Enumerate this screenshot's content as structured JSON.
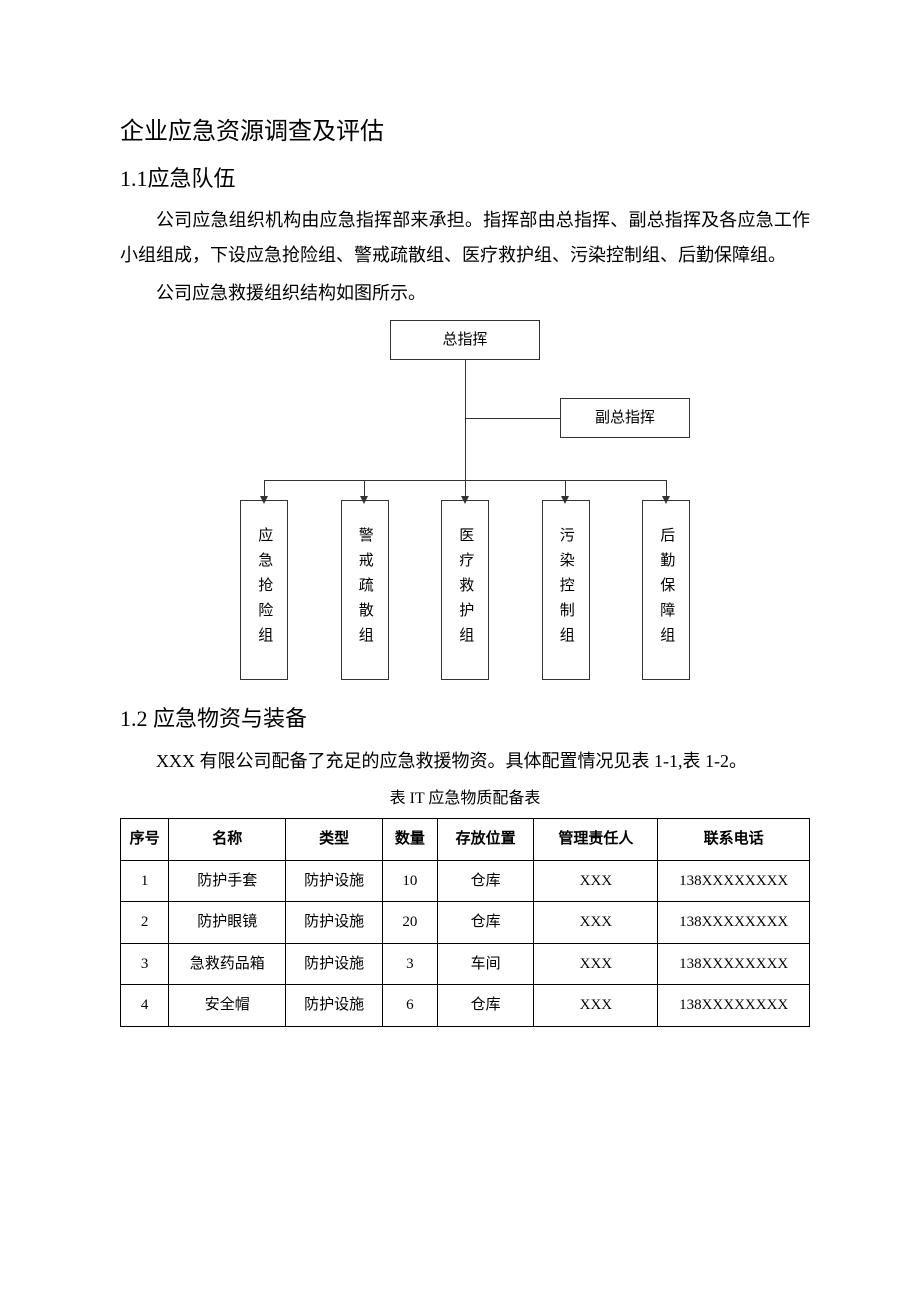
{
  "doc_title": "企业应急资源调查及评估",
  "sec11": {
    "heading": "1.1应急队伍",
    "para1": "公司应急组织机构由应急指挥部来承担。指挥部由总指挥、副总指挥及各应急工作小组组成，下设应急抢险组、警戒疏散组、医疗救护组、污染控制组、后勤保障组。",
    "para2": "公司应急救援组织结构如图所示。"
  },
  "chart_data": {
    "type": "diagram",
    "root": "总指挥",
    "deputy": "副总指挥",
    "leaves": [
      "应急抢险组",
      "警戒疏散组",
      "医疗救护组",
      "污染控制组",
      "后勤保障组"
    ]
  },
  "sec12": {
    "heading": "1.2 应急物资与装备",
    "para1": "XXX 有限公司配备了充足的应急救援物资。具体配置情况见表 1-1,表 1-2。"
  },
  "table1": {
    "caption": "表 IT 应急物质配备表",
    "headers": [
      "序号",
      "名称",
      "类型",
      "数量",
      "存放位置",
      "管理责任人",
      "联系电话"
    ],
    "rows": [
      {
        "no": "1",
        "name": "防护手套",
        "type": "防护设施",
        "qty": "10",
        "loc": "仓库",
        "owner": "XXX",
        "tel": "138XXXXXXXX"
      },
      {
        "no": "2",
        "name": "防护眼镜",
        "type": "防护设施",
        "qty": "20",
        "loc": "仓库",
        "owner": "XXX",
        "tel": "138XXXXXXXX"
      },
      {
        "no": "3",
        "name": "急救药品箱",
        "type": "防护设施",
        "qty": "3",
        "loc": "车间",
        "owner": "XXX",
        "tel": "138XXXXXXXX"
      },
      {
        "no": "4",
        "name": "安全帽",
        "type": "防护设施",
        "qty": "6",
        "loc": "仓库",
        "owner": "XXX",
        "tel": "138XXXXXXXX"
      }
    ]
  }
}
